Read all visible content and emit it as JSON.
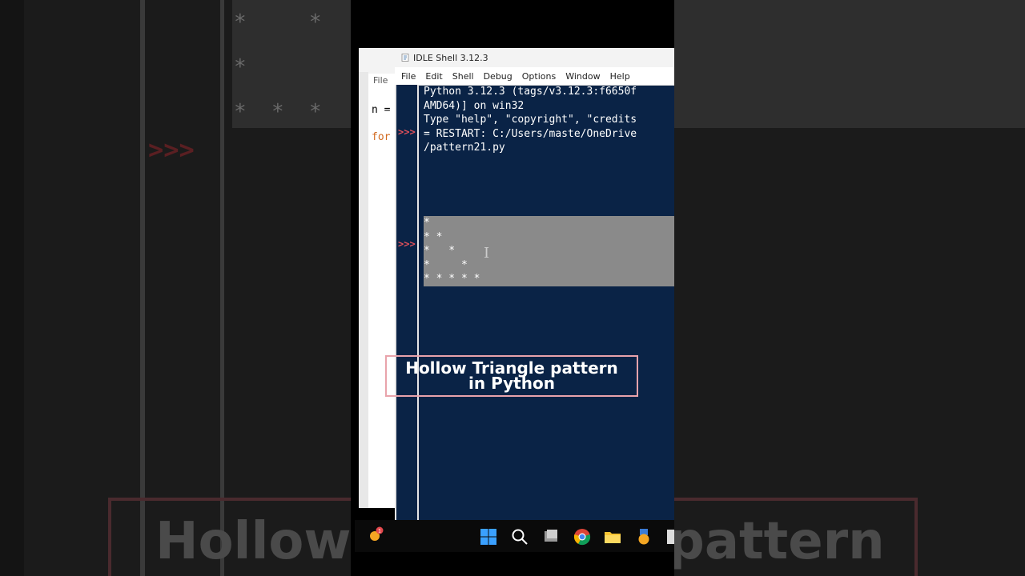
{
  "window": {
    "title": "IDLE Shell 3.12.3",
    "menu": [
      "File",
      "Edit",
      "Shell",
      "Debug",
      "Options",
      "Window",
      "Help"
    ]
  },
  "back_window": {
    "menu_file": "File",
    "code_line1": "n =",
    "code_line2": "for"
  },
  "shell": {
    "lines": [
      "Python 3.12.3 (tags/v3.12.3:f6650f",
      "AMD64)] on win32",
      "Type \"help\", \"copyright\", \"credits",
      "",
      "= RESTART: C:/Users/maste/OneDrive",
      "/pattern21.py"
    ],
    "output": [
      "*",
      "* *",
      "*   *",
      "*     *",
      "* * * * *"
    ],
    "prompt": ">>>"
  },
  "caption": {
    "line1": "Hollow Triangle pattern",
    "line2": "in Python"
  },
  "background": {
    "stars": "*     *\n*\n*  *  *",
    "prompt": ">>>",
    "big_left": "Hollow",
    "big_right": "pattern"
  },
  "taskbar": {
    "notification_count": "1",
    "icons": [
      "weather-icon",
      "windows-start-icon",
      "search-icon",
      "task-view-icon",
      "chrome-icon",
      "file-explorer-icon",
      "security-icon"
    ]
  },
  "colors": {
    "shell_bg": "#0a2346",
    "prompt": "#e0505a",
    "caption_border": "#e9a3ab",
    "selection": "#8a8a8a"
  }
}
